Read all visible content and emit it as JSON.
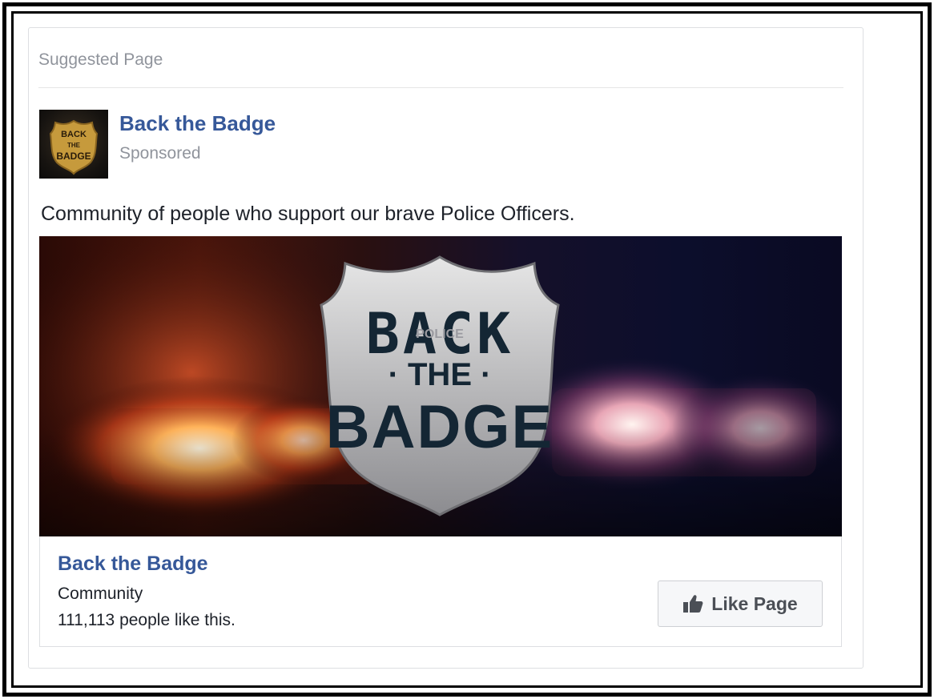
{
  "post": {
    "header_label": "Suggested Page",
    "page_name": "Back the Badge",
    "sponsored_label": "Sponsored",
    "text": "Community of people who support our brave Police Officers.",
    "avatar_badge_lines": [
      "BACK",
      "THE",
      "BADGE"
    ],
    "hero": {
      "badge_lines": [
        "BACK",
        "· THE ·",
        "BADGE"
      ],
      "badge_small_text": "POLICE",
      "icon": "police-shield-badge"
    }
  },
  "footer": {
    "page_name": "Back the Badge",
    "category": "Community",
    "likes_text": "111,113 people like this.",
    "like_button_label": "Like Page",
    "like_icon": "thumbs-up-icon"
  },
  "colors": {
    "link_blue": "#365899",
    "muted_gray": "#90949c",
    "text_dark": "#1d2129",
    "button_bg": "#f6f7f9"
  }
}
